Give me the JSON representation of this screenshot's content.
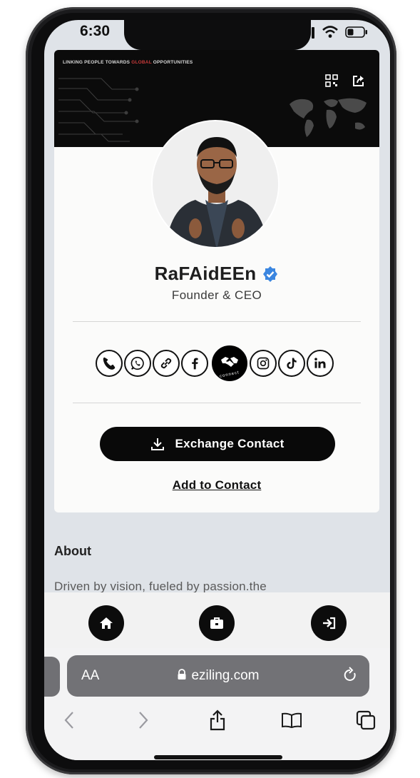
{
  "status_bar": {
    "time": "6:30",
    "icons": [
      "signal-icon",
      "wifi-icon",
      "battery-icon"
    ]
  },
  "banner": {
    "tagline_part1": "LINKING PEOPLE TOWARDS ",
    "tagline_highlight": "GLOBAL",
    "tagline_part2": " OPPORTUNITIES",
    "icons": [
      "qr-code-icon",
      "share-icon"
    ]
  },
  "profile": {
    "name": "RaFAidEEn",
    "title": "Founder & CEO",
    "verified_icon": "verified-badge-icon",
    "avatar_alt": "profile-photo"
  },
  "socials": [
    {
      "name": "phone-icon"
    },
    {
      "name": "whatsapp-icon"
    },
    {
      "name": "link-icon"
    },
    {
      "name": "facebook-icon"
    },
    {
      "name": "connect-icon",
      "label": "connect"
    },
    {
      "name": "instagram-icon"
    },
    {
      "name": "tiktok-icon"
    },
    {
      "name": "linkedin-icon"
    }
  ],
  "actions": {
    "exchange_label": "Exchange Contact",
    "add_label": "Add to Contact"
  },
  "about": {
    "title": "About",
    "text": "Driven by vision, fueled by passion.the"
  },
  "bottom_nav": [
    "home-icon",
    "briefcase-icon",
    "login-icon"
  ],
  "browser": {
    "text_size_label": "AA",
    "url": "eziling.com",
    "toolbar": [
      "back-icon",
      "forward-icon",
      "share-icon",
      "bookmarks-icon",
      "tabs-icon"
    ]
  },
  "colors": {
    "accent": "#090909",
    "highlight": "#c93a3a",
    "verified": "#3b86e0"
  }
}
